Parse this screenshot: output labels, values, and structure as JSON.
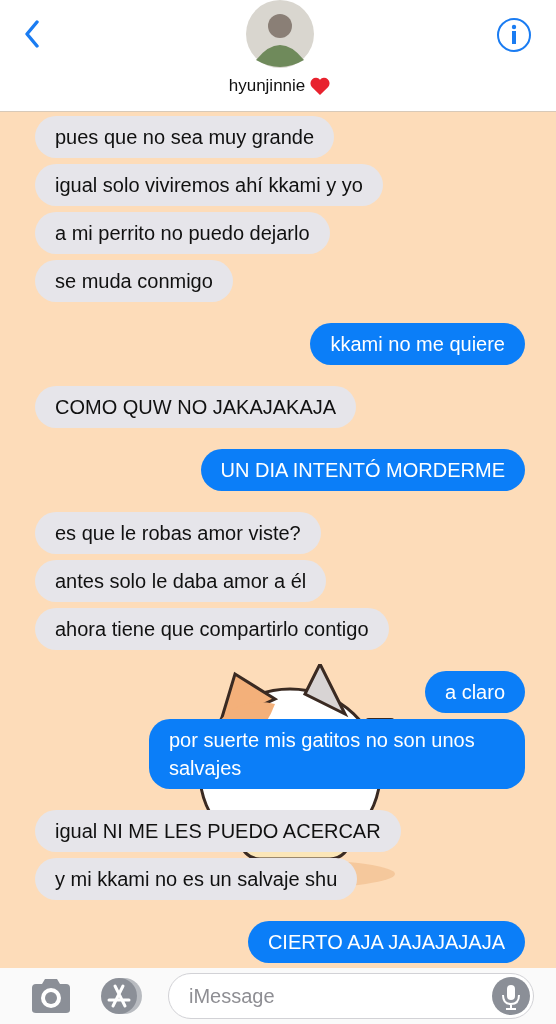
{
  "header": {
    "contact_name": "hyunjinnie"
  },
  "messages": [
    {
      "kind": "received",
      "text": "pues que no sea muy grande"
    },
    {
      "kind": "received",
      "text": "igual solo viviremos ahí kkami y yo"
    },
    {
      "kind": "received",
      "text": "a mi perrito no puedo dejarlo"
    },
    {
      "kind": "received",
      "text": "se muda conmigo"
    },
    {
      "kind": "sent",
      "text": "kkami no me quiere"
    },
    {
      "kind": "received",
      "text": "COMO QUW NO JAKAJAKAJA"
    },
    {
      "kind": "sent",
      "text": "UN DIA INTENTÓ MORDERME"
    },
    {
      "kind": "received",
      "text": "es que le robas amor viste?"
    },
    {
      "kind": "received",
      "text": "antes solo le daba amor a él"
    },
    {
      "kind": "received",
      "text": "ahora tiene que compartirlo contigo"
    },
    {
      "kind": "sent",
      "text": "a claro"
    },
    {
      "kind": "sent",
      "text": "por suerte mis gatitos no son unos salvajes"
    },
    {
      "kind": "received",
      "text": "igual NI ME LES PUEDO ACERCAR"
    },
    {
      "kind": "received",
      "text": "y mi kkami no es un salvaje shu"
    },
    {
      "kind": "sent",
      "text": "CIERTO AJA JAJAJAJAJA"
    }
  ],
  "composer": {
    "placeholder": "iMessage"
  }
}
